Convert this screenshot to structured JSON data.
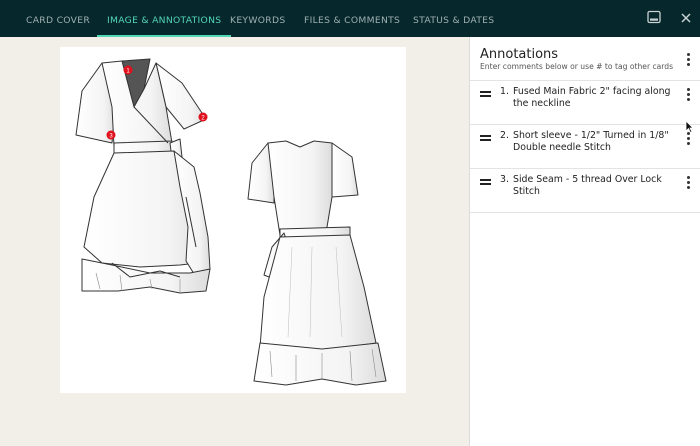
{
  "tabs": [
    {
      "label": "CARD COVER",
      "active": false
    },
    {
      "label": "IMAGE & ANNOTATIONS",
      "active": true
    },
    {
      "label": "KEYWORDS",
      "active": false
    },
    {
      "label": "FILES & COMMENTS",
      "active": false
    },
    {
      "label": "STATUS & DATES",
      "active": false
    }
  ],
  "toolbar": {
    "panel_toggle_icon": "panel-icon",
    "close_icon": "close-icon"
  },
  "image": {
    "markers": [
      "1",
      "2",
      "3"
    ],
    "marker_color": "#e0101d"
  },
  "panel": {
    "title": "Annotations",
    "subtitle": "Enter comments below or use # to tag other cards",
    "annotations": [
      {
        "number": "1.",
        "text": "Fused Main Fabric 2\" facing along the neckline"
      },
      {
        "number": "2.",
        "text": "Short sleeve - 1/2\" Turned in 1/8\" Double needle Stitch"
      },
      {
        "number": "3.",
        "text": "Side Seam - 5 thread Over Lock Stitch"
      }
    ]
  },
  "colors": {
    "topbar": "#06272b",
    "active_tab": "#53d7b9",
    "canvas": "#f2efe8"
  }
}
